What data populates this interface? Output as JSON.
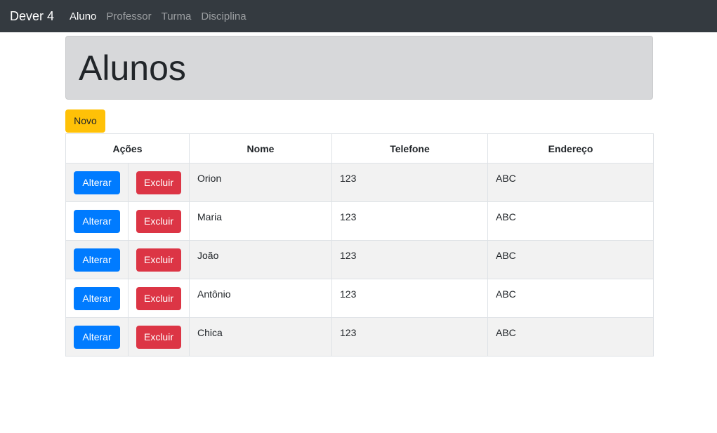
{
  "navbar": {
    "brand": "Dever 4",
    "links": [
      {
        "label": "Aluno",
        "active": true
      },
      {
        "label": "Professor",
        "active": false
      },
      {
        "label": "Turma",
        "active": false
      },
      {
        "label": "Disciplina",
        "active": false
      }
    ]
  },
  "page": {
    "title": "Alunos",
    "new_button": "Novo"
  },
  "table": {
    "headers": [
      "Ações",
      "Nome",
      "Telefone",
      "Endereço"
    ],
    "edit_label": "Alterar",
    "delete_label": "Excluir",
    "rows": [
      {
        "nome": "Orion",
        "telefone": "123",
        "endereco": "ABC"
      },
      {
        "nome": "Maria",
        "telefone": "123",
        "endereco": "ABC"
      },
      {
        "nome": "João",
        "telefone": "123",
        "endereco": "ABC"
      },
      {
        "nome": "Antônio",
        "telefone": "123",
        "endereco": "ABC"
      },
      {
        "nome": "Chica",
        "telefone": "123",
        "endereco": "ABC"
      }
    ]
  },
  "colors": {
    "navbar": "#343a40",
    "primary": "#007bff",
    "danger": "#dc3545",
    "warning": "#ffc107"
  }
}
